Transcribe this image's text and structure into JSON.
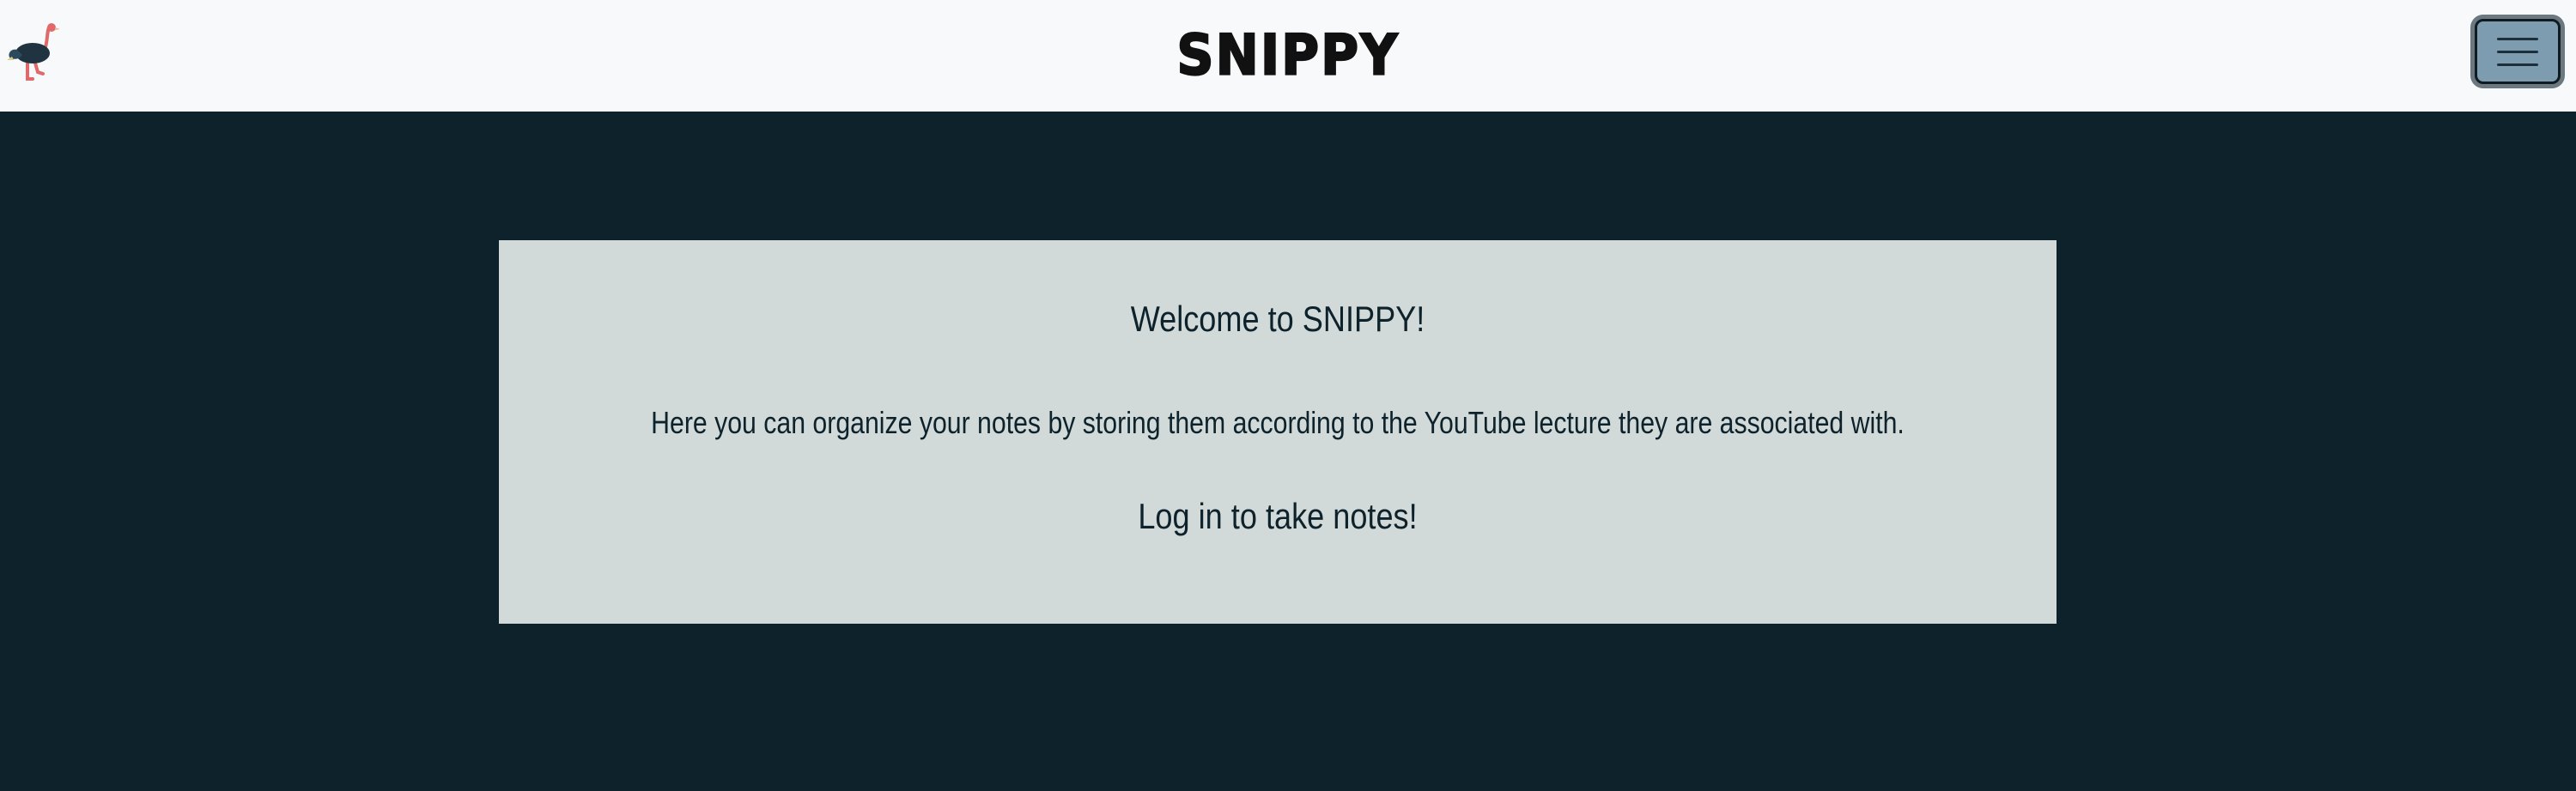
{
  "navbar": {
    "brand": "SNIPPY",
    "logo_icon": "ostrich-icon",
    "menu_icon": "hamburger-menu-icon"
  },
  "card": {
    "welcome": "Welcome to SNIPPY!",
    "description": "Here you can organize your notes by storing them according to the YouTube lecture they are associated with.",
    "login_prompt": "Log in to take notes!"
  },
  "colors": {
    "navbar_bg": "#f8f9fa",
    "page_bg": "#0d222b",
    "card_bg": "#d2d9d9",
    "toggler_bg": "#7e9caf"
  }
}
